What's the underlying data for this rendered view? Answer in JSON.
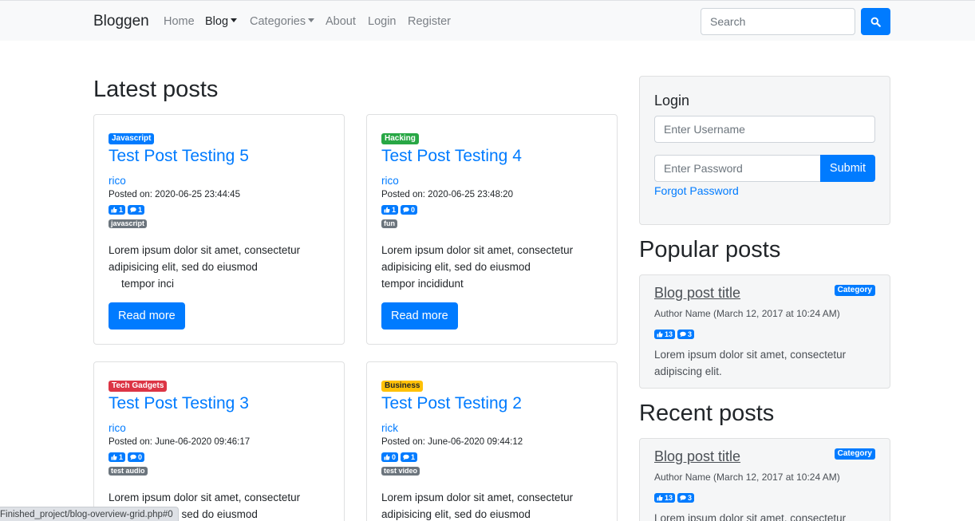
{
  "navbar": {
    "brand": "Bloggen",
    "links": [
      "Home",
      "Blog",
      "Categories",
      "About",
      "Login",
      "Register"
    ],
    "search_placeholder": "Search"
  },
  "main": {
    "heading": "Latest posts",
    "read_more_label": "Read more",
    "posts": [
      {
        "category": "Javascript",
        "category_color": "#007bff",
        "category_text": "#ffffff",
        "title": "Test Post Testing 5",
        "author": "rico",
        "posted": "Posted on: 2020-06-25 23:44:45",
        "likes": "1",
        "comments": "1",
        "tag": "javascript",
        "excerpt_1": "Lorem ipsum dolor sit amet, consectetur",
        "excerpt_2": "adipisicing elit, sed do eiusmod",
        "excerpt_3": "tempor inci"
      },
      {
        "category": "Hacking",
        "category_color": "#28a745",
        "category_text": "#ffffff",
        "title": "Test Post Testing 4",
        "author": "rico",
        "posted": "Posted on: 2020-06-25 23:48:20",
        "likes": "1",
        "comments": "0",
        "tag": "fun",
        "excerpt_1": "Lorem ipsum dolor sit amet, consectetur",
        "excerpt_2": "adipisicing elit, sed do eiusmod",
        "excerpt_3": "tempor incididunt"
      },
      {
        "category": "Tech Gadgets",
        "category_color": "#dc3545",
        "category_text": "#ffffff",
        "title": "Test Post Testing 3",
        "author": "rico",
        "posted": "Posted on: June-06-2020 09:46:17",
        "likes": "1",
        "comments": "0",
        "tag": "test audio",
        "excerpt_1": "Lorem ipsum dolor sit amet, consectetur",
        "excerpt_2": "adipisicing elit, sed do eiusmod",
        "excerpt_3": ""
      },
      {
        "category": "Business",
        "category_color": "#ffc107",
        "category_text": "#212529",
        "title": "Test Post Testing 2",
        "author": "rick",
        "posted": "Posted on: June-06-2020 09:44:12",
        "likes": "0",
        "comments": "1",
        "tag": "test video",
        "excerpt_1": "Lorem ipsum dolor sit amet, consectetur",
        "excerpt_2": "adipisicing elit, sed do eiusmod",
        "excerpt_3": ""
      }
    ]
  },
  "sidebar": {
    "login": {
      "title": "Login",
      "username_placeholder": "Enter Username",
      "password_placeholder": "Enter Password",
      "submit_label": "Submit",
      "forgot_label": "Forgot Password"
    },
    "popular": {
      "heading": "Popular posts",
      "title": "Blog post title",
      "category": "Category",
      "author": "Author Name (March 12, 2017 at 10:24 AM)",
      "likes": "13",
      "comments": "3",
      "excerpt_1": "Lorem ipsum dolor sit amet, consectetur",
      "excerpt_2": "adipiscing elit."
    },
    "recent": {
      "heading": "Recent posts",
      "title": "Blog post title",
      "category": "Category",
      "author": "Author Name (March 12, 2017 at 10:24 AM)",
      "likes": "13",
      "comments": "3",
      "excerpt_1": "Lorem ipsum dolor sit amet, consectetur"
    }
  },
  "status_bar": {
    "text": "Finished_project/blog-overview-grid.php#0"
  },
  "colors": {
    "primary": "#007bff",
    "navbar_bg": "#f8f9fa",
    "tag_gray": "#6c757d"
  },
  "icons": [
    "search-icon",
    "thumbs-up-icon",
    "comment-icon",
    "caret-down-icon"
  ]
}
